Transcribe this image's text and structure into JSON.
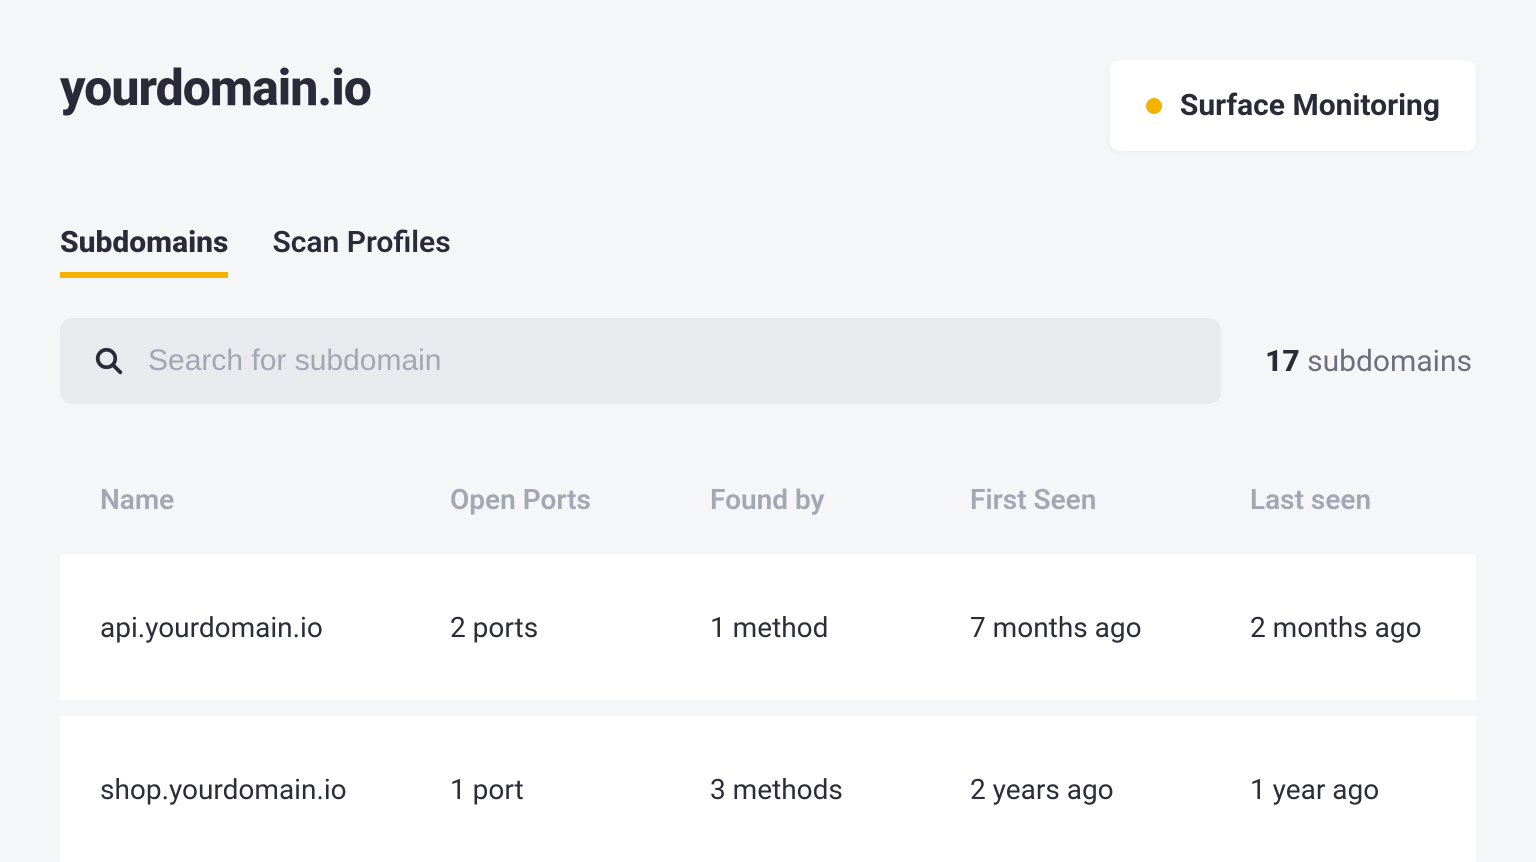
{
  "header": {
    "title": "yourdomain.io",
    "badge_label": "Surface Monitoring",
    "badge_color": "#f5b301"
  },
  "tabs": [
    {
      "label": "Subdomains",
      "active": true
    },
    {
      "label": "Scan Profiles",
      "active": false
    }
  ],
  "search": {
    "placeholder": "Search for subdomain",
    "value": ""
  },
  "count": {
    "number": "17",
    "label": " subdomains"
  },
  "table": {
    "columns": [
      "Name",
      "Open Ports",
      "Found by",
      "First Seen",
      "Last seen"
    ],
    "rows": [
      {
        "name": "api.yourdomain.io",
        "open_ports": "2 ports",
        "found_by": "1 method",
        "first_seen": "7 months ago",
        "last_seen": "2 months ago"
      },
      {
        "name": "shop.yourdomain.io",
        "open_ports": "1 port",
        "found_by": "3 methods",
        "first_seen": "2 years ago",
        "last_seen": "1 year ago"
      }
    ]
  }
}
